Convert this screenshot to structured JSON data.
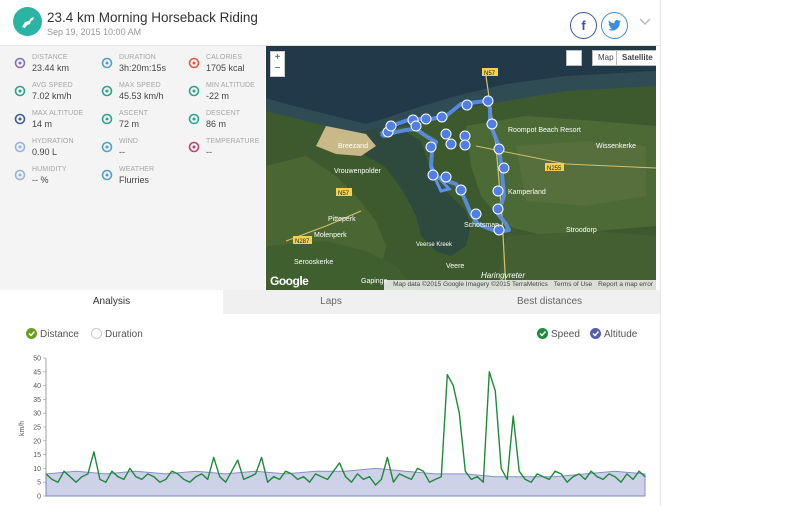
{
  "header": {
    "title": "23.4 km Morning Horseback Riding",
    "subtitle": "Sep 19, 2015 10:00 AM",
    "share_facebook": "f",
    "share_twitter": "t"
  },
  "stats": [
    {
      "label": "DISTANCE",
      "value": "23.44 km",
      "icon": "route-icon"
    },
    {
      "label": "DURATION",
      "value": "3h:20m:15s",
      "icon": "stopwatch-icon"
    },
    {
      "label": "CALORIES",
      "value": "1705 kcal",
      "icon": "flame-icon"
    },
    {
      "label": "AVG SPEED",
      "value": "7.02 km/h",
      "icon": "speedometer-icon"
    },
    {
      "label": "MAX SPEED",
      "value": "45.53 km/h",
      "icon": "speedometer-max-icon"
    },
    {
      "label": "MIN ALTITUDE",
      "value": "-22 m",
      "icon": "mountain-min-icon"
    },
    {
      "label": "MAX ALTITUDE",
      "value": "14 m",
      "icon": "mountain-max-icon"
    },
    {
      "label": "ASCENT",
      "value": "72 m",
      "icon": "ascent-icon"
    },
    {
      "label": "DESCENT",
      "value": "86 m",
      "icon": "descent-icon"
    },
    {
      "label": "HYDRATION",
      "value": "0.90 L",
      "icon": "drops-icon"
    },
    {
      "label": "WIND",
      "value": "--",
      "icon": "wind-icon"
    },
    {
      "label": "TEMPERATURE",
      "value": "--",
      "icon": "thermometer-icon"
    },
    {
      "label": "HUMIDITY",
      "value": "-- %",
      "icon": "humidity-icon"
    },
    {
      "label": "WEATHER",
      "value": "Flurries",
      "icon": "snowflake-icon"
    }
  ],
  "map": {
    "zoom_in": "+",
    "zoom_out": "−",
    "type_map": "Map",
    "type_satellite": "Satellite",
    "attribution": "Map data ©2015 Google Imagery ©2015 TerraMetrics",
    "terms": "Terms of Use",
    "report": "Report a map error",
    "logo": "Google",
    "labels": {
      "breezand": "Breezand",
      "vrouwenpolder": "Vrouwenpolder",
      "pitteperk": "Pitteperk",
      "molenperk": "Molenperk",
      "serooskerke": "Serooskerke",
      "veere": "Veere",
      "veerse_kreek": "Veerse\nKreek",
      "kamperland": "Kamperland",
      "wissenkerke": "Wissenkerke",
      "stroodorp": "Stroodorp",
      "schotsman": "Schotsman",
      "haringvreter": "Haringvreter",
      "roompot": "Roompot Beach Resort",
      "n57_top": "N57",
      "n57_mid": "N57",
      "n255": "N255",
      "n287": "N287",
      "gapinge": "Gapinge"
    }
  },
  "tabs": [
    "Analysis",
    "Laps",
    "Best distances"
  ],
  "chart_legend": {
    "distance": "Distance",
    "duration": "Duration",
    "speed": "Speed",
    "altitude": "Altitude"
  },
  "colors": {
    "speed": "#1f8a3c",
    "altitude_fill": "#c9cee6",
    "altitude_line": "#7b82bf",
    "route": "#5b8ff0",
    "accent": "#2bb3a3"
  },
  "chart_data": {
    "type": "line",
    "ylabel": "km/h",
    "ylim": [
      0,
      50
    ],
    "y_ticks": [
      0,
      5,
      10,
      15,
      20,
      25,
      30,
      35,
      40,
      45,
      50
    ],
    "x_index_range": [
      0,
      100
    ],
    "series": [
      {
        "name": "Speed",
        "x": [
          0,
          1,
          2,
          3,
          4,
          5,
          6,
          7,
          8,
          9,
          10,
          11,
          12,
          13,
          14,
          15,
          16,
          17,
          18,
          19,
          20,
          21,
          22,
          23,
          24,
          25,
          26,
          27,
          28,
          29,
          30,
          31,
          32,
          33,
          34,
          35,
          36,
          37,
          38,
          39,
          40,
          41,
          42,
          43,
          44,
          45,
          46,
          47,
          48,
          49,
          50,
          51,
          52,
          53,
          54,
          55,
          56,
          57,
          58,
          59,
          60,
          61,
          62,
          63,
          64,
          65,
          66,
          67,
          68,
          69,
          70,
          71,
          72,
          73,
          74,
          75,
          76,
          77,
          78,
          79,
          80,
          81,
          82,
          83,
          84,
          85,
          86,
          87,
          88,
          89,
          90,
          91,
          92,
          93,
          94,
          95,
          96,
          97,
          98,
          99,
          100
        ],
        "values": [
          8,
          6,
          5,
          9,
          7,
          5,
          7,
          8,
          16,
          6,
          5,
          9,
          7,
          6,
          10,
          7,
          6,
          8,
          7,
          5,
          6,
          9,
          8,
          6,
          5,
          7,
          8,
          6,
          14,
          7,
          5,
          9,
          13,
          6,
          7,
          8,
          14,
          5,
          7,
          6,
          9,
          8,
          6,
          7,
          5,
          8,
          7,
          6,
          9,
          12,
          7,
          5,
          8,
          6,
          7,
          4,
          6,
          14,
          5,
          8,
          7,
          6,
          10,
          9,
          5,
          6,
          7,
          44,
          40,
          30,
          9,
          6,
          7,
          5,
          45,
          38,
          10,
          6,
          29,
          9,
          6,
          5,
          8,
          7,
          6,
          9,
          8,
          5,
          7,
          8,
          6,
          9,
          7,
          6,
          8,
          7,
          5,
          8,
          6,
          9,
          7
        ]
      },
      {
        "name": "Altitude",
        "x": [
          0,
          5,
          10,
          15,
          20,
          25,
          30,
          35,
          40,
          45,
          50,
          55,
          60,
          65,
          70,
          75,
          80,
          85,
          90,
          95,
          100
        ],
        "values": [
          8,
          9,
          8,
          9,
          8,
          9,
          8,
          9,
          8,
          9,
          9,
          10,
          9,
          8,
          8,
          7,
          7,
          7,
          8,
          9,
          8
        ]
      }
    ]
  }
}
